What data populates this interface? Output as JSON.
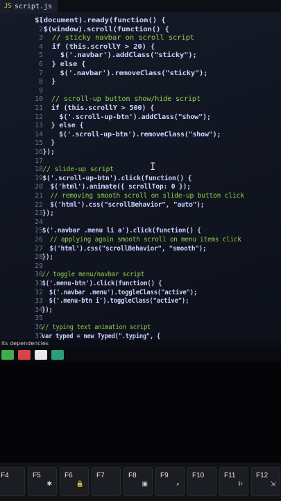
{
  "editor": {
    "tab_label": "script.js",
    "tab_icon": "JS",
    "lines": [
      {
        "n": "1",
        "t": "$(document).ready(function() {",
        "k": "code"
      },
      {
        "n": "2",
        "t": "  $(window).scroll(function() {",
        "k": "code"
      },
      {
        "n": "3",
        "t": "    // sticky navbar on scroll script",
        "k": "cmt"
      },
      {
        "n": "4",
        "t": "    if (this.scrollY > 20) {",
        "k": "code"
      },
      {
        "n": "5",
        "t": "      $('.navbar').addClass(\"sticky\");",
        "k": "code"
      },
      {
        "n": "6",
        "t": "    } else {",
        "k": "code"
      },
      {
        "n": "7",
        "t": "      $('.navbar').removeClass(\"sticky\");",
        "k": "code"
      },
      {
        "n": "8",
        "t": "    }",
        "k": "code"
      },
      {
        "n": "9",
        "t": "",
        "k": "code"
      },
      {
        "n": "10",
        "t": "    // scroll-up button show/hide script",
        "k": "cmt"
      },
      {
        "n": "11",
        "t": "    if (this.scrollY > 500) {",
        "k": "code"
      },
      {
        "n": "12",
        "t": "      $('.scroll-up-btn').addClass(\"show\");",
        "k": "code"
      },
      {
        "n": "13",
        "t": "    } else {",
        "k": "code"
      },
      {
        "n": "14",
        "t": "      $('.scroll-up-btn').removeClass(\"show\");",
        "k": "code"
      },
      {
        "n": "15",
        "t": "    }",
        "k": "code"
      },
      {
        "n": "16",
        "t": "  });",
        "k": "code"
      },
      {
        "n": "17",
        "t": "",
        "k": "code"
      },
      {
        "n": "18",
        "t": "  // slide-up script",
        "k": "cmt"
      },
      {
        "n": "19",
        "t": "  $('.scroll-up-btn').click(function() {",
        "k": "code"
      },
      {
        "n": "20",
        "t": "    $('html').animate({ scrollTop: 0 });",
        "k": "code"
      },
      {
        "n": "21",
        "t": "    // removing smooth scroll on slide-up button click",
        "k": "cmt"
      },
      {
        "n": "22",
        "t": "    $('html').css(\"scrollBehavior\", \"auto\");",
        "k": "code"
      },
      {
        "n": "23",
        "t": "  });",
        "k": "code"
      },
      {
        "n": "24",
        "t": "",
        "k": "code"
      },
      {
        "n": "25",
        "t": "  $('.navbar .menu li a').click(function() {",
        "k": "code"
      },
      {
        "n": "26",
        "t": "    // applying again smooth scroll on menu items click",
        "k": "cmt"
      },
      {
        "n": "27",
        "t": "    $('html').css(\"scrollBehavior\", \"smooth\");",
        "k": "code"
      },
      {
        "n": "28",
        "t": "  });",
        "k": "code"
      },
      {
        "n": "29",
        "t": "",
        "k": "code"
      },
      {
        "n": "30",
        "t": "  // toggle menu/navbar script",
        "k": "cmt"
      },
      {
        "n": "31",
        "t": "  $('.menu-btn').click(function() {",
        "k": "code"
      },
      {
        "n": "32",
        "t": "    $('.navbar .menu').toggleClass(\"active\");",
        "k": "code"
      },
      {
        "n": "33",
        "t": "    $('.menu-btn i').toggleClass(\"active\");",
        "k": "code"
      },
      {
        "n": "34",
        "t": "  });",
        "k": "code"
      },
      {
        "n": "35",
        "t": "",
        "k": "code"
      },
      {
        "n": "36",
        "t": "  // typing text animation script",
        "k": "cmt"
      },
      {
        "n": "37",
        "t": "  var typed = new Typed(\".typing\", {",
        "k": "code"
      }
    ]
  },
  "status_text": "its dependencies",
  "keyboard": {
    "keys": [
      {
        "label": "F4",
        "icon": ""
      },
      {
        "label": "F5",
        "icon": "✱"
      },
      {
        "label": "F6",
        "icon": "🔒"
      },
      {
        "label": "F7",
        "icon": ""
      },
      {
        "label": "F8",
        "icon": "▣"
      },
      {
        "label": "F9",
        "icon": "⌕"
      },
      {
        "label": "F10",
        "icon": ""
      },
      {
        "label": "F11",
        "icon": "⊪"
      },
      {
        "label": "F12",
        "icon": "⇲"
      }
    ]
  },
  "colors": {
    "code": "#c9d3ff",
    "comment": "#8fd14f",
    "background": "#131827"
  }
}
